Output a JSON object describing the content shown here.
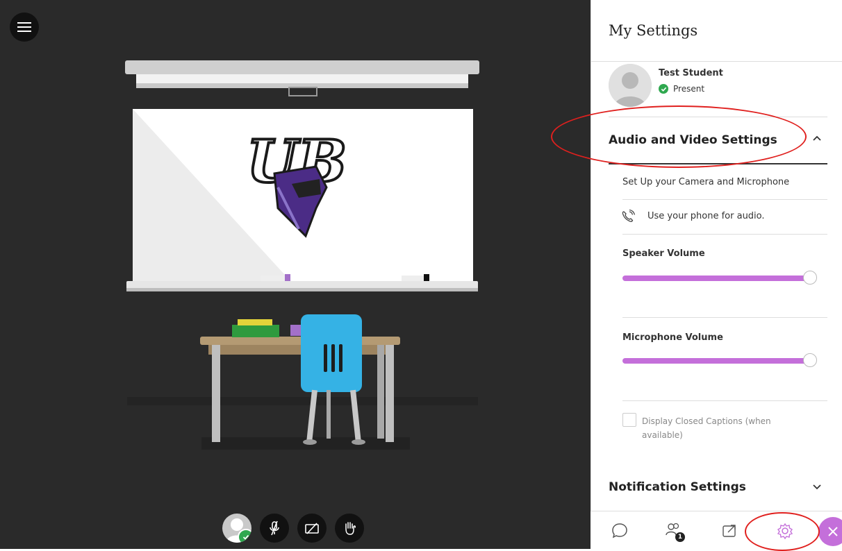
{
  "panel": {
    "title": "My Settings",
    "user": {
      "name": "Test Student",
      "status": "Present"
    },
    "audio_video": {
      "header": "Audio and Video Settings",
      "setup_link": "Set Up your Camera and Microphone",
      "phone_link": "Use your phone for audio.",
      "speaker_label": "Speaker Volume",
      "speaker_level": 1.0,
      "mic_label": "Microphone Volume",
      "mic_level": 1.0,
      "captions_label": "Display Closed Captions (when available)"
    },
    "notifications": {
      "header": "Notification Settings"
    }
  },
  "tabbar": {
    "attendees_count": "1"
  },
  "icons": {
    "menu": "hamburger-icon",
    "mic": "microphone-muted-icon",
    "camera": "camera-off-icon",
    "hand": "raise-hand-icon",
    "chat": "chat-icon",
    "attendees": "attendees-icon",
    "share": "share-content-icon",
    "settings": "gear-icon",
    "close": "close-icon"
  },
  "colors": {
    "accent": "#c46fda",
    "present": "#2fa84f",
    "annotation": "#e0201e",
    "stage": "#2a2a2a"
  }
}
